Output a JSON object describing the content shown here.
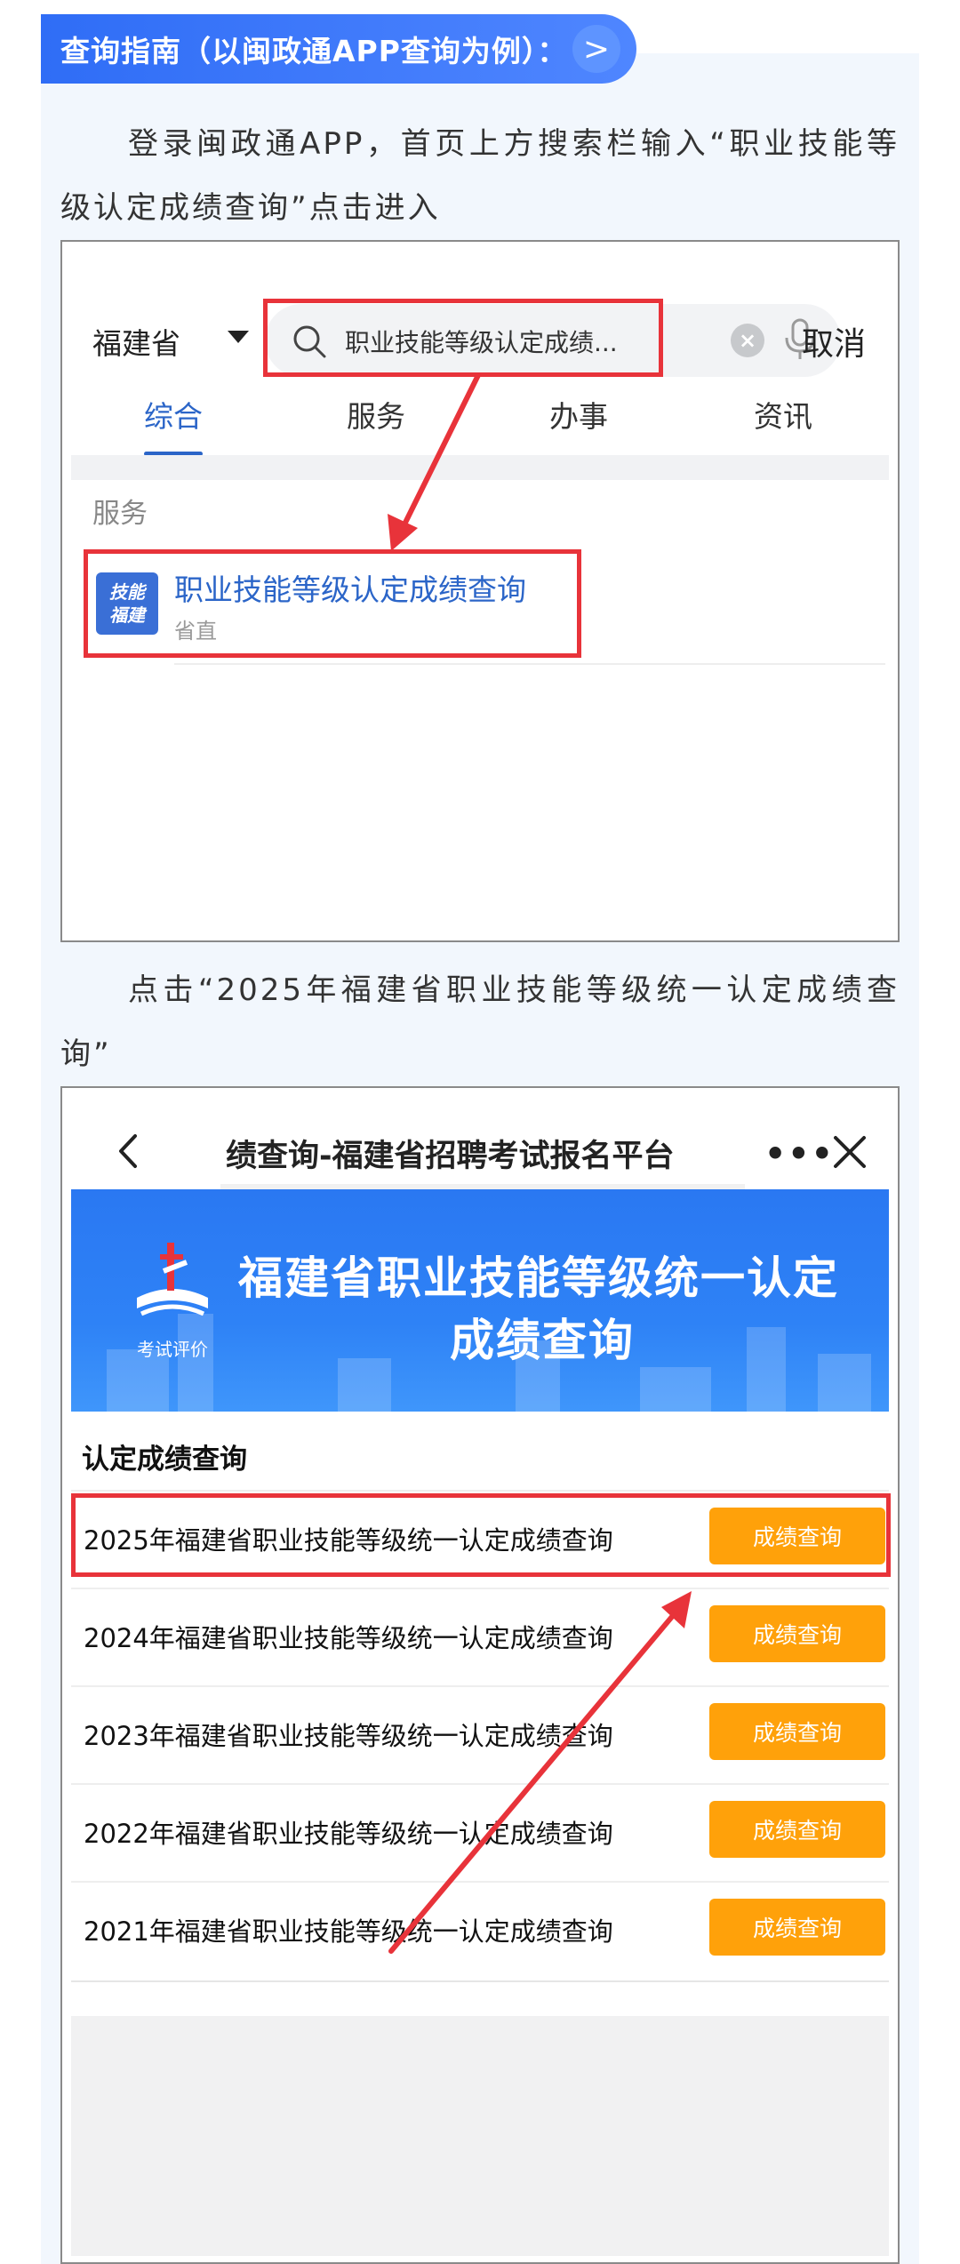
{
  "guide": {
    "title": "查询指南（以闽政通APP查询为例）：",
    "chevron": ">"
  },
  "steps": [
    {
      "text": "登录闽政通APP，首页上方搜索栏输入“职业技能等级认定成绩查询”点击进入"
    },
    {
      "text": "点击“2025年福建省职业技能等级统一认定成绩查询”"
    }
  ],
  "app_search": {
    "province": "福建省",
    "search_value": "职业技能等级认定成绩...",
    "cancel_label": "取消",
    "tabs": [
      {
        "label": "综合",
        "active": true
      },
      {
        "label": "服务",
        "active": false
      },
      {
        "label": "办事",
        "active": false
      },
      {
        "label": "资讯",
        "active": false
      }
    ],
    "section_label": "服务",
    "result": {
      "icon_text_line1": "技能",
      "icon_text_line2": "福建",
      "title": "职业技能等级认定成绩查询",
      "subtitle": "省直"
    }
  },
  "score_page": {
    "nav_title": "绩查询-福建省招聘考试报名平台",
    "more_label": "•••",
    "banner": {
      "logo_text": "考试评价",
      "title_line1": "福建省职业技能等级统一认定",
      "title_line2": "成绩查询"
    },
    "section_title": "认定成绩查询",
    "rows": [
      {
        "label": "2025年福建省职业技能等级统一认定成绩查询",
        "button": "成绩查询",
        "highlighted": true
      },
      {
        "label": "2024年福建省职业技能等级统一认定成绩查询",
        "button": "成绩查询",
        "highlighted": false
      },
      {
        "label": "2023年福建省职业技能等级统一认定成绩查询",
        "button": "成绩查询",
        "highlighted": false
      },
      {
        "label": "2022年福建省职业技能等级统一认定成绩查询",
        "button": "成绩查询",
        "highlighted": false
      },
      {
        "label": "2021年福建省职业技能等级统一认定成绩查询",
        "button": "成绩查询",
        "highlighted": false
      }
    ]
  },
  "colors": {
    "accent_blue": "#2f6df6",
    "highlight_red": "#e8333a",
    "button_orange": "#ffa10a",
    "link_blue": "#2b65c8"
  }
}
